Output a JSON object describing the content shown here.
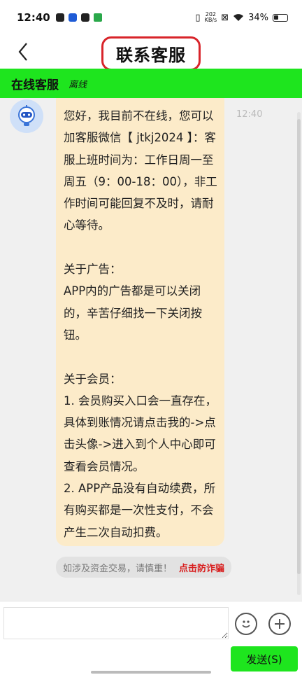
{
  "status_bar": {
    "time": "12:40",
    "net_speed_value": "202",
    "net_speed_unit": "KB/s",
    "battery": "34%"
  },
  "header": {
    "title": "联系客服"
  },
  "service_bar": {
    "title": "在线客服",
    "status": "离线"
  },
  "message": {
    "time": "12:40",
    "text": "您好，我目前不在线，您可以加客服微信【 jtkj2024 】：客服上班时间为：工作日周一至周五（9：00-18：00），非工作时间可能回复不及时，请耐心等待。\n\n关于广告：\nAPP内的广告都是可以关闭的，辛苦仔细找一下关闭按钮。\n\n关于会员：\n1. 会员购买入口会一直存在，具体到账情况请点击我的->点击头像->进入到个人中心即可查看会员情况。\n2. APP产品没有自动续费，所有购买都是一次性支付，不会产生二次自动扣费。"
  },
  "fraud_notice": {
    "text": "如涉及资金交易，请慎重！",
    "link": "点击防诈骗"
  },
  "input": {
    "placeholder": "",
    "send_label": "发送(S)"
  },
  "colors": {
    "accent_green": "#1ee51e",
    "bubble_bg": "#fcebc9",
    "highlight_red": "#d8242a"
  },
  "icons": [
    "back-arrow-icon",
    "robot-avatar-icon",
    "emoji-icon",
    "plus-icon"
  ]
}
